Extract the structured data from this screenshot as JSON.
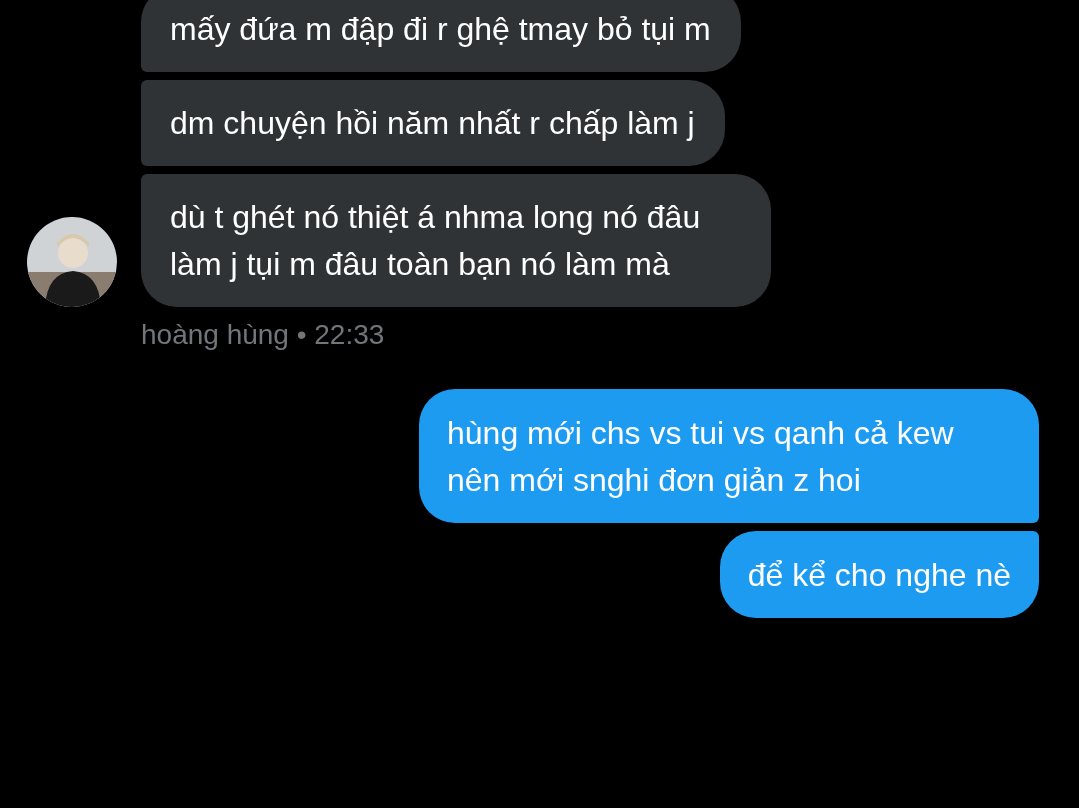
{
  "messages": [
    {
      "kind": "received",
      "text": "mấy đứa m đập đi r ghệ tmay bỏ tụi m"
    },
    {
      "kind": "received",
      "text": "dm chuyện hồi năm nhất r chấp làm j"
    },
    {
      "kind": "received",
      "text": "dù t ghét nó thiệt á nhma long nó đâu làm j tụi m đâu toàn bạn nó làm mà"
    },
    {
      "kind": "meta",
      "text": "hoàng hùng • 22:33"
    },
    {
      "kind": "sent",
      "text": "hùng mới chs vs tui vs qanh cả kew nên mới snghi đơn giản z hoi"
    },
    {
      "kind": "sent",
      "text": "để kể cho nghe nè"
    }
  ]
}
